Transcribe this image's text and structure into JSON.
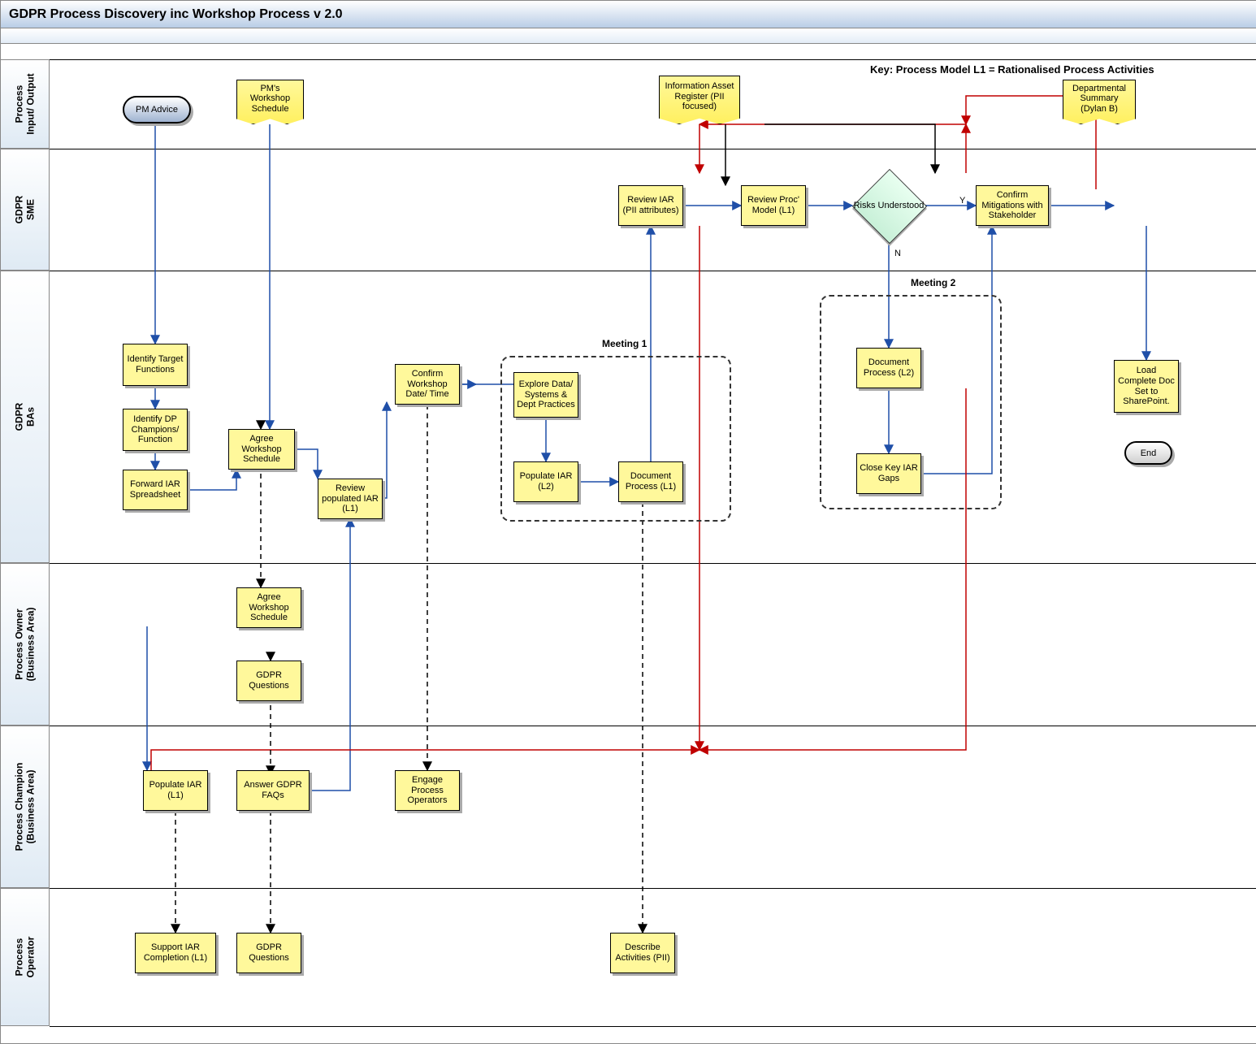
{
  "title": "GDPR Process Discovery inc Workshop Process v 2.0",
  "key_text": "Key: Process Model L1 = Rationalised Process Activities",
  "lanes": {
    "io": "Process\nInput/ Output",
    "sme": "GDPR\nSME",
    "bas": "GDPR\nBAs",
    "owner": "Process Owner\n(Business Area)",
    "champion": "Process Champion\n(Business Area)",
    "operator": "Process\nOperator"
  },
  "nodes": {
    "pm_advice": "PM Advice",
    "pm_workshop_schedule": "PM's Workshop Schedule",
    "info_asset_register": "Information Asset Register (PII focused)",
    "dept_summary": "Departmental Summary (Dylan B)",
    "review_iar_pii": "Review IAR (PII attributes)",
    "review_proc_model": "Review Proc' Model (L1)",
    "risks_understood": "Risks Understood",
    "confirm_mitigations": "Confirm Mitigations with Stakeholder",
    "identify_target_functions": "Identify Target Functions",
    "identify_dp_champions": "Identify DP Champions/ Function",
    "forward_iar_spreadsheet": "Forward IAR Spreadsheet",
    "agree_workshop_schedule": "Agree Workshop Schedule",
    "review_populated_iar": "Review populated IAR (L1)",
    "confirm_workshop_date": "Confirm Workshop Date/ Time",
    "explore_data": "Explore Data/ Systems & Dept Practices",
    "populate_iar_l2": "Populate IAR (L2)",
    "document_process_l1": "Document Process (L1)",
    "document_process_l2": "Document Process (L2)",
    "close_key_iar_gaps": "Close Key IAR Gaps",
    "load_complete_doc_set": "Load Complete Doc Set to SharePoint.",
    "end": "End",
    "agree_workshop_schedule_owner": "Agree Workshop Schedule",
    "gdpr_questions_owner": "GDPR Questions",
    "populate_iar_l1": "Populate IAR (L1)",
    "answer_gdpr_faqs": "Answer GDPR FAQs",
    "engage_process_operators": "Engage Process Operators",
    "support_iar_completion": "Support IAR Completion (L1)",
    "gdpr_questions_op": "GDPR Questions",
    "describe_activities": "Describe Activities (PII)"
  },
  "groups": {
    "meeting1": "Meeting 1",
    "meeting2": "Meeting 2"
  },
  "decision_labels": {
    "yes": "Y",
    "no": "N"
  }
}
